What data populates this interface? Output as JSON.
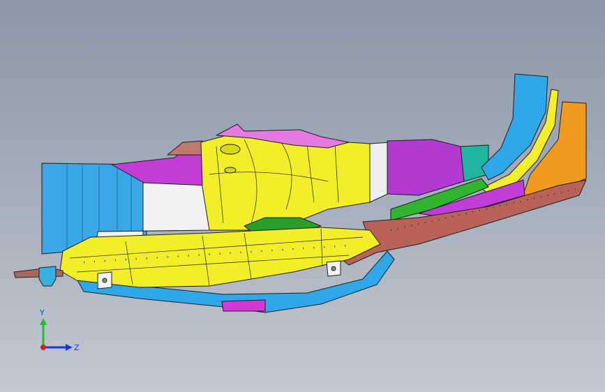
{
  "scene": {
    "colors": {
      "background_top": "#8c96a6",
      "background_bottom": "#c3c9d2",
      "yellow": "#f2ee2a",
      "cyan": "#2ea8e8",
      "magenta": "#c23cd8",
      "pink": "#e27ae0",
      "green": "#2fb52f",
      "orange": "#f29a20",
      "brown": "#b8625a",
      "white": "#f2f2f2",
      "outline": "#1e1e1e"
    }
  },
  "triad": {
    "y_label": "Y",
    "z_label": "Z",
    "y_color": "#1fbf2a",
    "z_color": "#1e3ad6",
    "x_color": "#d81e1e"
  }
}
